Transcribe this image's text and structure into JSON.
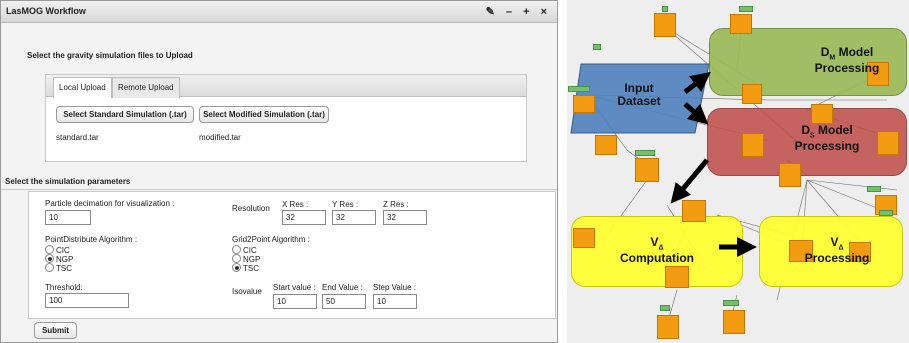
{
  "window": {
    "title": "LasMOG Workflow",
    "controls_glyphs": "― + ×",
    "wrench_glyph": "✎"
  },
  "upload": {
    "heading": "Select the gravity simulation files to Upload",
    "tabs": [
      "Local Upload",
      "Remote Upload"
    ],
    "select_standard_label": "Select Standard Simulation (.tar)",
    "select_modified_label": "Select Modified Simulation (.tar)",
    "standard_file": "standard.tar",
    "modified_file": "modified.tar"
  },
  "params": {
    "heading": "Select the simulation parameters",
    "particle_label": "Particle decimation for visualization :",
    "particle_value": "10",
    "resolution_label": "Resolution",
    "x_res_label": "X Res :",
    "y_res_label": "Y Res :",
    "z_res_label": "Z Res :",
    "x_res_value": "32",
    "y_res_value": "32",
    "z_res_value": "32",
    "pd_label": "PointDistribute Algorithm :",
    "pd_options": [
      "CIC",
      "NGP",
      "TSC"
    ],
    "pd_selected": "NGP",
    "g2p_label": "Grid2Point Algorithm :",
    "g2p_options": [
      "CIC",
      "NGP",
      "TSC"
    ],
    "g2p_selected": "TSC",
    "threshold_label": "Threshold:",
    "threshold_value": "100",
    "isovalue_label": "Isovalue",
    "start_label": "Start value :",
    "end_label": "End Value :",
    "step_label": "Step Value :",
    "start_value": "10",
    "end_value": "50",
    "step_value": "10",
    "submit_label": "Submit"
  },
  "diagram": {
    "input_dataset": "Input Dataset",
    "input_dataset_line1": "Input",
    "input_dataset_line2": "Dataset",
    "dm_main": "D",
    "dm_sub": "M",
    "dm_suffix": " Model",
    "dm_line2": "Processing",
    "ds_main": "D",
    "ds_sub": "S",
    "ds_suffix": " Model",
    "ds_line2": "Processing",
    "vc_main": "V",
    "vc_sub": "Δ",
    "vc_line2": "Computation",
    "vp_main": "V",
    "vp_sub": "Δ",
    "vp_line2": "Processing",
    "colors": {
      "dm_region": "#9bbb59",
      "ds_region": "#c0504d",
      "v_region": "#ffff33",
      "input_region": "#4f81bd",
      "node": "#f39c12",
      "port": "#74c16b"
    }
  }
}
